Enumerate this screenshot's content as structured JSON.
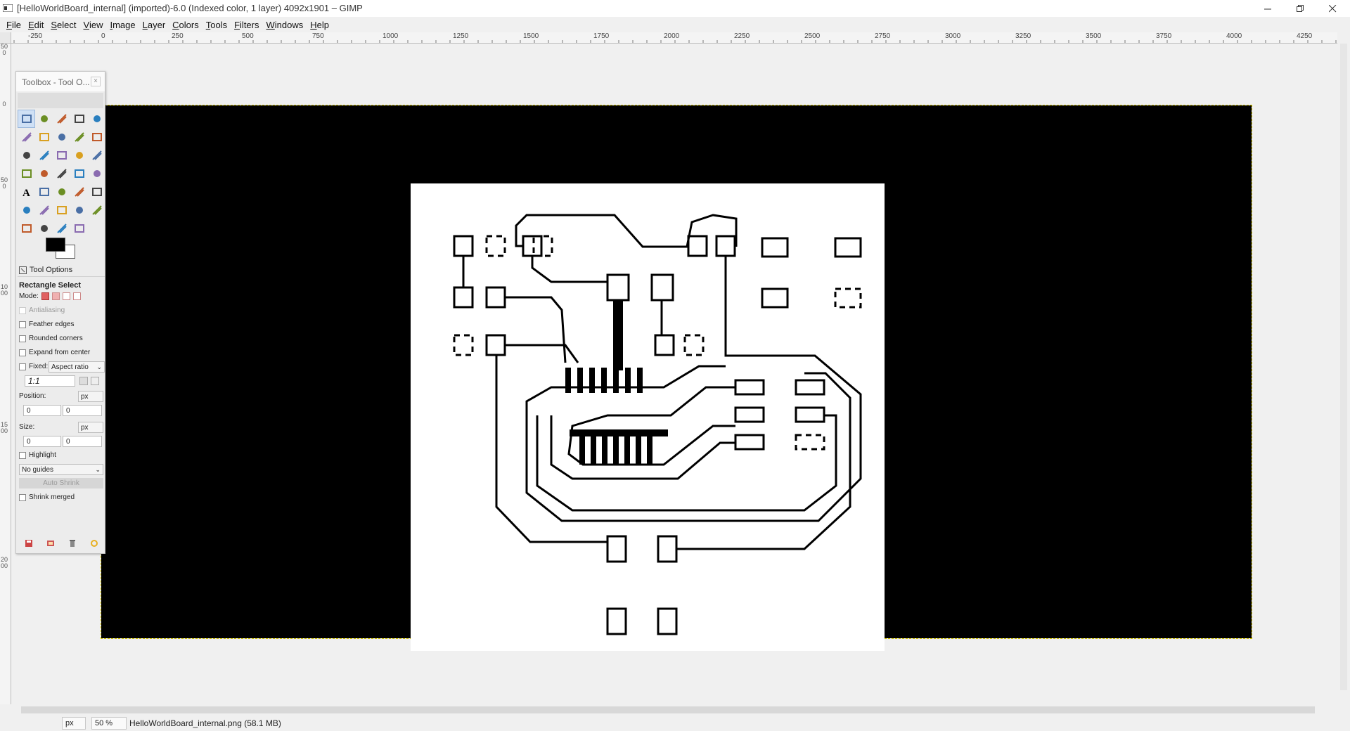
{
  "window": {
    "title": "[HelloWorldBoard_internal] (imported)-6.0 (Indexed color, 1 layer) 4092x1901 – GIMP",
    "icons": [
      "gimp-app-icon",
      "minimize-icon",
      "restore-icon",
      "close-icon"
    ]
  },
  "menubar": {
    "items": [
      "File",
      "Edit",
      "Select",
      "View",
      "Image",
      "Layer",
      "Colors",
      "Tools",
      "Filters",
      "Windows",
      "Help"
    ]
  },
  "ruler": {
    "horizontal_labels": [
      "-250",
      "0",
      "250",
      "500",
      "750",
      "1000",
      "1250",
      "1500",
      "1750",
      "2000",
      "2250",
      "2500",
      "2750",
      "3000",
      "3250",
      "3500",
      "3750",
      "4000",
      "4250"
    ],
    "vertical_labels": [
      "500",
      "0",
      "500",
      "1000",
      "1500",
      "2000"
    ]
  },
  "toolbox": {
    "title": "Toolbox - Tool O...",
    "close_label": "×",
    "tool_icons": [
      "rect-select-icon",
      "ellipse-select-icon",
      "free-select-icon",
      "fuzzy-select-icon",
      "color-select-icon",
      "scissors-select-icon",
      "foreground-select-icon",
      "paths-icon",
      "color-picker-icon",
      "zoom-icon",
      "measure-icon",
      "move-icon",
      "align-icon",
      "transform-icon",
      "unified-transform-icon",
      "crop-icon",
      "perspective-icon",
      "flip-icon",
      "cage-transform-icon",
      "warp-transform-icon",
      "text-icon",
      "bucket-fill-icon",
      "gradient-icon",
      "pencil-icon",
      "paintbrush-icon",
      "eraser-icon",
      "airbrush-icon",
      "ink-icon",
      "clone-icon",
      "heal-icon",
      "perspective-clone-icon",
      "blur-icon",
      "smudge-icon",
      "dodge-burn-icon"
    ],
    "foreground_color": "#000000",
    "background_color": "#ffffff"
  },
  "tool_options": {
    "tab_label": "Tool Options",
    "tool_name": "Rectangle Select",
    "mode_label": "Mode:",
    "antialiasing": "Antialiasing",
    "feather_edges": "Feather edges",
    "rounded_corners": "Rounded corners",
    "expand_from_center": "Expand from center",
    "fixed_label": "Fixed:",
    "fixed_value": "Aspect ratio",
    "ratio_value": "1:1",
    "position_label": "Position:",
    "position_unit": "px",
    "position_x": "0",
    "position_y": "0",
    "size_label": "Size:",
    "size_unit": "px",
    "size_w": "0",
    "size_h": "0",
    "highlight": "Highlight",
    "guides_value": "No guides",
    "auto_shrink": "Auto Shrink",
    "shrink_merged": "Shrink merged",
    "bottom_icons": [
      "save-options-icon",
      "restore-options-icon",
      "delete-options-icon",
      "reset-options-icon"
    ]
  },
  "statusbar": {
    "unit": "px",
    "zoom": "50 %",
    "file_info": "HelloWorldBoard_internal.png (58.1 MB)"
  },
  "colors": {
    "canvas_bg": "#f0f0f0",
    "image_bg": "#000000",
    "board_bg": "#ffffff",
    "active_tool": "#cfe0f5"
  }
}
